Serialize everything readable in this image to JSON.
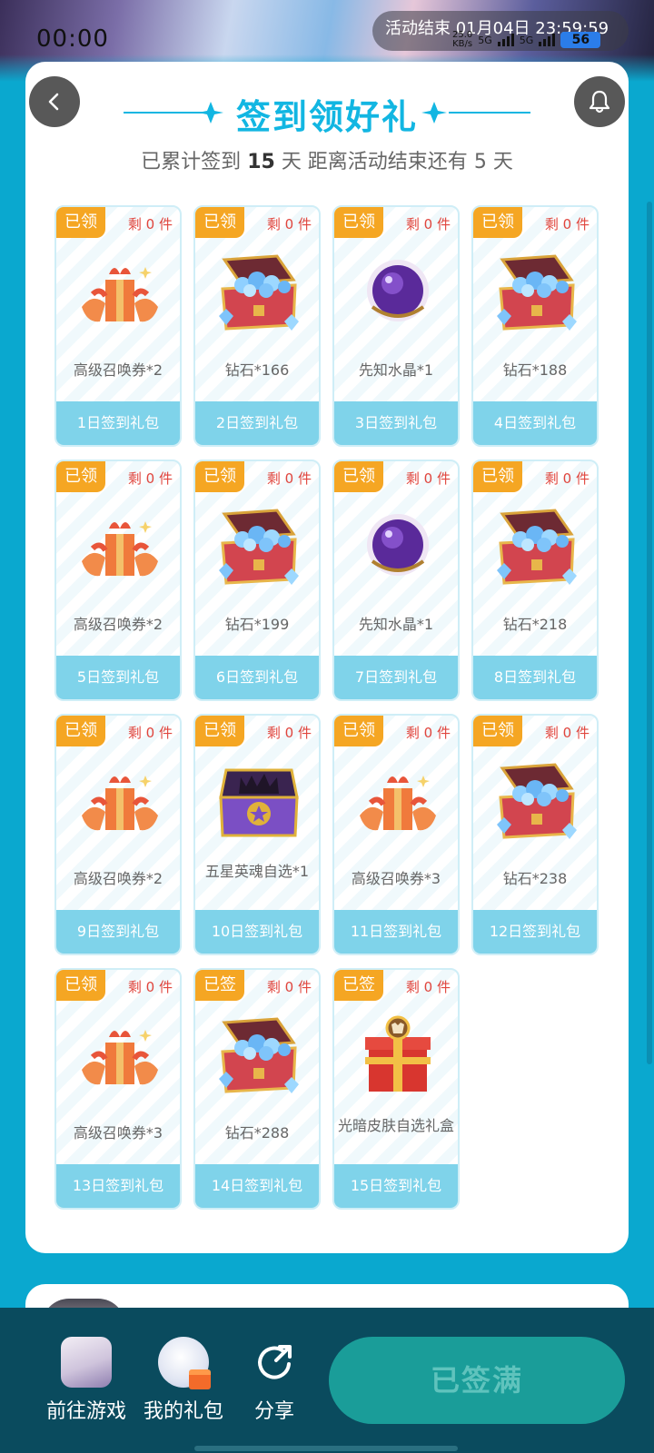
{
  "status_bar": {
    "time": "00:00",
    "event_end": "活动结束 01月04日 23:59:59",
    "net_speed_value": "25.0",
    "net_speed_unit": "KB/s",
    "sim1": "5G",
    "sim2": "5G",
    "battery": "56"
  },
  "header": {
    "title": "签到领好礼",
    "summary_prefix": "已累计签到",
    "signed_days": "15",
    "summary_mid": "天  距离活动结束还有",
    "remaining_days": "5",
    "summary_suffix": "天"
  },
  "gifts": [
    {
      "status": "已领",
      "remain": "剩 0 件",
      "name": "高级召唤券*2",
      "day": "1日签到礼包",
      "icon": "gift-bundle"
    },
    {
      "status": "已领",
      "remain": "剩 0 件",
      "name": "钻石*166",
      "day": "2日签到礼包",
      "icon": "diamond-chest"
    },
    {
      "status": "已领",
      "remain": "剩 0 件",
      "name": "先知水晶*1",
      "day": "3日签到礼包",
      "icon": "crystal-orb"
    },
    {
      "status": "已领",
      "remain": "剩 0 件",
      "name": "钻石*188",
      "day": "4日签到礼包",
      "icon": "diamond-chest"
    },
    {
      "status": "已领",
      "remain": "剩 0 件",
      "name": "高级召唤券*2",
      "day": "5日签到礼包",
      "icon": "gift-bundle"
    },
    {
      "status": "已领",
      "remain": "剩 0 件",
      "name": "钻石*199",
      "day": "6日签到礼包",
      "icon": "diamond-chest"
    },
    {
      "status": "已领",
      "remain": "剩 0 件",
      "name": "先知水晶*1",
      "day": "7日签到礼包",
      "icon": "crystal-orb"
    },
    {
      "status": "已领",
      "remain": "剩 0 件",
      "name": "钻石*218",
      "day": "8日签到礼包",
      "icon": "diamond-chest"
    },
    {
      "status": "已领",
      "remain": "剩 0 件",
      "name": "高级召唤券*2",
      "day": "9日签到礼包",
      "icon": "gift-bundle"
    },
    {
      "status": "已领",
      "remain": "剩 0 件",
      "name": "五星英魂自选*1",
      "day": "10日签到礼包",
      "icon": "star-chest"
    },
    {
      "status": "已领",
      "remain": "剩 0 件",
      "name": "高级召唤券*3",
      "day": "11日签到礼包",
      "icon": "gift-bundle"
    },
    {
      "status": "已领",
      "remain": "剩 0 件",
      "name": "钻石*238",
      "day": "12日签到礼包",
      "icon": "diamond-chest"
    },
    {
      "status": "已领",
      "remain": "剩 0 件",
      "name": "高级召唤券*3",
      "day": "13日签到礼包",
      "icon": "gift-bundle"
    },
    {
      "status": "已签",
      "remain": "剩 0 件",
      "name": "钻石*288",
      "day": "14日签到礼包",
      "icon": "diamond-chest"
    },
    {
      "status": "已签",
      "remain": "剩 0 件",
      "name": "光暗皮肤自选礼盒",
      "day": "15日签到礼包",
      "icon": "red-gift-box"
    }
  ],
  "bottom_nav": {
    "game_label": "前往游戏",
    "gifts_label": "我的礼包",
    "share_label": "分享",
    "action_label": "已签满"
  },
  "colors": {
    "accent": "#12b6e2",
    "status_badge": "#f5a623",
    "remain_text": "#e0453d",
    "day_bar": "#7fd3ea",
    "bottom_bar": "#0a4b5e",
    "action_button": "#1a9d99"
  }
}
